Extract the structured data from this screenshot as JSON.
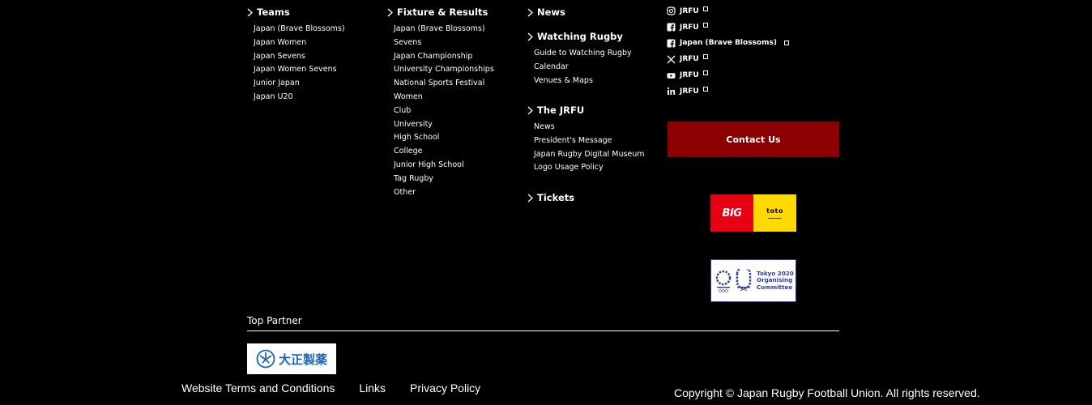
{
  "teams": {
    "title": "Teams",
    "items": [
      "Japan (Brave Blossoms)",
      "Japan Women",
      "Japan Sevens",
      "Japan Women Sevens",
      "Junior Japan",
      "Japan U20"
    ]
  },
  "fixtures": {
    "title": "Fixture & Results",
    "items": [
      "Japan (Brave Blossoms)",
      "Sevens",
      "Japan Championship",
      "University Championships",
      "National Sports Festival",
      "Women",
      "Club",
      "University",
      "High School",
      "College",
      "Junior High School",
      "Tag Rugby",
      "Other"
    ]
  },
  "news": {
    "title": "News"
  },
  "watching": {
    "title": "Watching Rugby",
    "items": [
      "Guide to Watching Rugby",
      "Calendar",
      "Venues & Maps"
    ]
  },
  "jrfu": {
    "title": "The JRFU",
    "items": [
      "News",
      "President's Message",
      "Japan Rugby Digital Museum",
      "Logo Usage Policy"
    ]
  },
  "tickets": {
    "title": "Tickets"
  },
  "social": [
    {
      "icon": "instagram-icon",
      "label": "JRFU"
    },
    {
      "icon": "facebook-icon",
      "label": "JRFU"
    },
    {
      "icon": "facebook-icon",
      "label": "Japan (Brave Blossoms)"
    },
    {
      "icon": "x-icon",
      "label": "JRFU"
    },
    {
      "icon": "youtube-icon",
      "label": "JRFU"
    },
    {
      "icon": "linkedin-icon",
      "label": "JRFU"
    }
  ],
  "contact": {
    "label": "Contact Us",
    "color": "#8b0000"
  },
  "sponsors": {
    "big_text": "BIG",
    "toto_text": "toto",
    "tokyo_lines": [
      "Tokyo 2020",
      "Organising",
      "Committee"
    ]
  },
  "partner": {
    "label": "Top Partner",
    "logo_text": "大正製薬"
  },
  "footer": {
    "links": [
      "Website Terms and Conditions",
      "Links",
      "Privacy Policy"
    ],
    "copyright": "Copyright © Japan Rugby Football Union. All rights reserved."
  }
}
